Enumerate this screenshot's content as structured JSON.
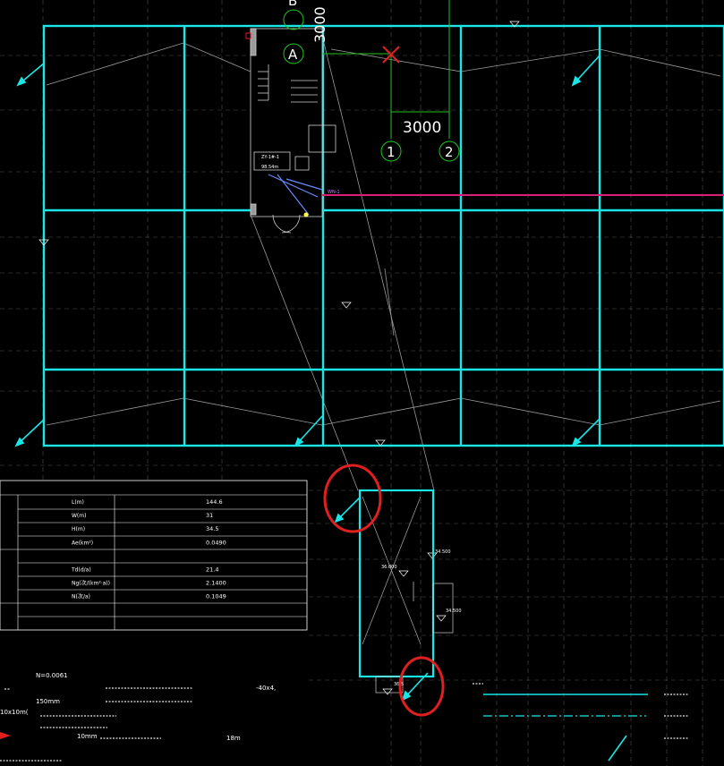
{
  "drawing": {
    "axis_labels": {
      "A": "A",
      "B": "B",
      "c1": "1",
      "c2": "2"
    },
    "dim_horizontal": "3000",
    "dim_vertical": "3000",
    "room_label_top": "ZY-1#-1",
    "room_label_bottom": "98.54m",
    "pink_line_label": "WN-1",
    "table": {
      "title": "",
      "rows": [
        {
          "name": "L(m)",
          "value": "144.6"
        },
        {
          "name": "W(m)",
          "value": "31"
        },
        {
          "name": "H(m)",
          "value": "34.5"
        },
        {
          "name": "Ae(km²)",
          "value": "0.0490"
        },
        {
          "name": "",
          "value": ""
        },
        {
          "name": "Td(d/a)",
          "value": "21.4"
        },
        {
          "name": "Ng(次/(km²·a))",
          "value": "2.1400"
        },
        {
          "name": "N(次/a)",
          "value": "0.1049"
        },
        {
          "name": "",
          "value": ""
        }
      ]
    },
    "notes": {
      "n_value": "N=0.0061",
      "line1_right": "-40x4,",
      "size_1": "150mm",
      "size_2": "10x10m(",
      "size_3": "10mm",
      "size_4": "18m"
    },
    "inset_labels": {
      "a": "34.500",
      "b": "36.000",
      "c": "34.500",
      "d": "36.5"
    }
  },
  "colors": {
    "background": "#000000",
    "cyan": "#19e6e6",
    "grid": "#8a8a8a",
    "green": "#1fc21f",
    "red": "#e02020",
    "magenta": "#d81f78",
    "white": "#ffffff"
  }
}
